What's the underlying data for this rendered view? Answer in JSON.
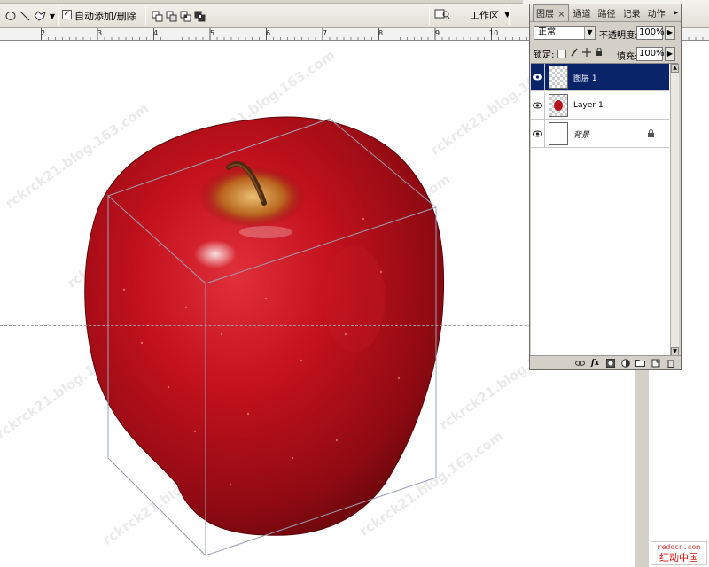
{
  "options_bar": {
    "auto_add_delete_label": "自动添加/删除",
    "auto_add_delete_checked": "✓",
    "workspace_label": "工作区"
  },
  "ruler": {
    "ticks": [
      "2",
      "3",
      "4",
      "5",
      "6",
      "7",
      "8",
      "9",
      "10"
    ]
  },
  "layers_panel": {
    "tabs": [
      "图层",
      "通道",
      "路径",
      "记录",
      "动作"
    ],
    "close_glyph": "×",
    "menu_glyph": "▸",
    "blend_mode": "正常",
    "opacity_label": "不透明度:",
    "opacity_value": "100%",
    "lock_label": "锁定:",
    "fill_label": "填充:",
    "fill_value": "100%",
    "layers": [
      {
        "name": "图层 1",
        "selected": true
      },
      {
        "name": "Layer 1",
        "selected": false
      },
      {
        "name": "背景",
        "selected": false,
        "locked": true
      }
    ],
    "bottom_buttons": [
      "link-icon",
      "fx-icon",
      "mask-icon",
      "adjustment-icon",
      "group-icon",
      "new-layer-icon",
      "trash-icon"
    ],
    "fx_label": "fx"
  },
  "canvas": {
    "watermark_text": "rckrck21.blog.163.com"
  },
  "stamp": {
    "domain": "redocn.com",
    "name": "红动中国"
  },
  "colors": {
    "selection": "#0a246a",
    "panel_bg": "#d4d0c8",
    "apple_red": "#b5101c"
  }
}
